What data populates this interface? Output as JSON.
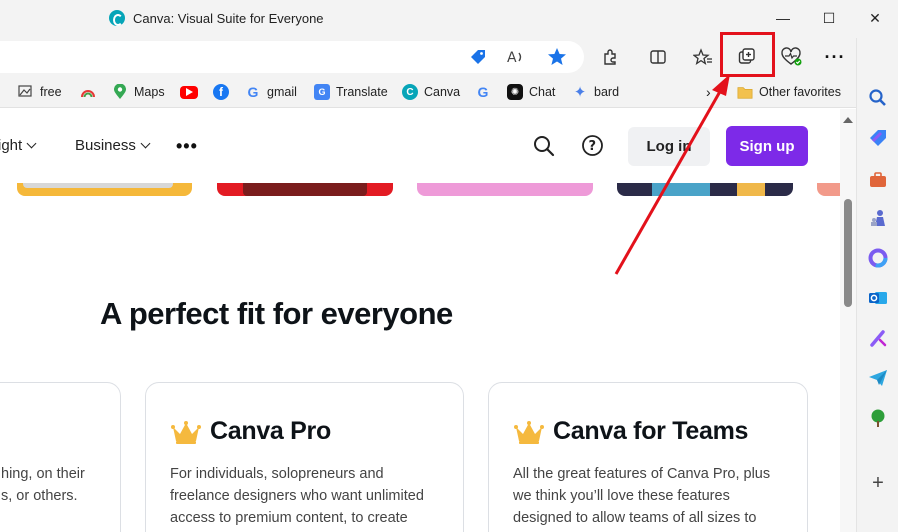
{
  "window": {
    "title": "Canva: Visual Suite for Everyone",
    "controls": {
      "minimize": "—",
      "maximize": "☐",
      "close": "✕"
    }
  },
  "favorites": [
    {
      "label": "free",
      "icon": "image-icon"
    },
    {
      "label": "",
      "icon": "rainbow-icon"
    },
    {
      "label": "Maps",
      "icon": "maps-pin-icon"
    },
    {
      "label": "",
      "icon": "youtube-icon"
    },
    {
      "label": "",
      "icon": "facebook-icon"
    },
    {
      "label": "gmail",
      "icon": "google-icon"
    },
    {
      "label": "Translate",
      "icon": "translate-icon"
    },
    {
      "label": "Canva",
      "icon": "canva-icon"
    },
    {
      "label": "",
      "icon": "google-icon"
    },
    {
      "label": "Chat",
      "icon": "chatgpt-icon"
    },
    {
      "label": "bard",
      "icon": "bard-sparkle-icon"
    }
  ],
  "other_favorites": "Other favorites",
  "nav": {
    "partial_item": "ight",
    "business": "Business",
    "login": "Log in",
    "signup": "Sign up"
  },
  "section": {
    "heading": "A perfect fit for everyone"
  },
  "cards": [
    {
      "title": "",
      "lines": [
        "hing, on their",
        "s, or others."
      ]
    },
    {
      "title": "Canva Pro",
      "lines": [
        "For individuals, solopreneurs and",
        "freelance designers who want unlimited",
        "access to premium content, to create"
      ]
    },
    {
      "title": "Canva for Teams",
      "lines": [
        "All the great features of Canva Pro, plus",
        "we think you’ll love these features",
        "designed to allow teams of all sizes to"
      ]
    }
  ],
  "colors": {
    "accent_purple": "#7d2ae8",
    "annotation_red": "#e3111b",
    "crown_gold": "#f5b93e"
  }
}
